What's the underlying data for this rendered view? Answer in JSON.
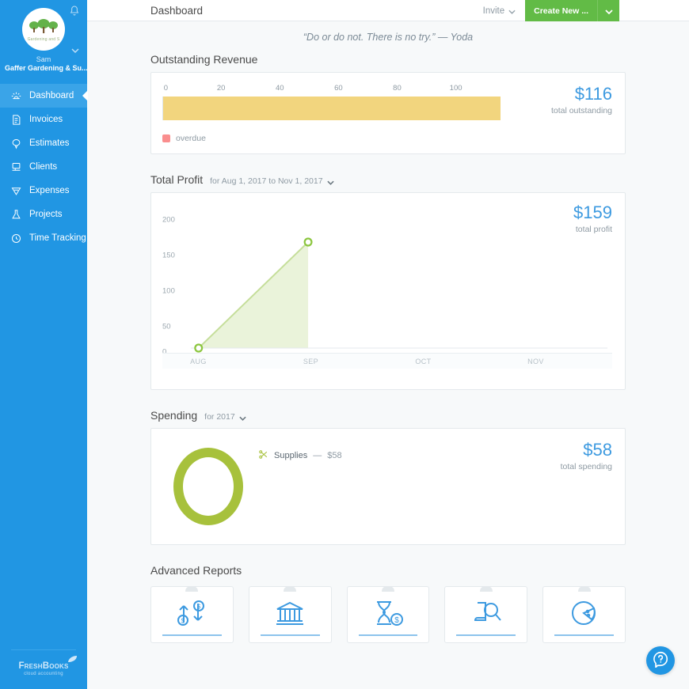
{
  "sidebar": {
    "bell_icon": "bell-icon",
    "avatar_icon": "gardening-trees-avatar",
    "avatar_caption": "Gardening and S",
    "user_name": "Sam",
    "company": "Gaffer Gardening & Su...",
    "account_caret": "chevron-down-icon",
    "items": [
      {
        "label": "Dashboard",
        "icon": "dashboard-sun-icon",
        "active": true
      },
      {
        "label": "Invoices",
        "icon": "invoice-icon",
        "active": false
      },
      {
        "label": "Estimates",
        "icon": "estimate-balloon-icon",
        "active": false
      },
      {
        "label": "Clients",
        "icon": "clients-icon",
        "active": false
      },
      {
        "label": "Expenses",
        "icon": "expenses-receipt-icon",
        "active": false
      },
      {
        "label": "Projects",
        "icon": "projects-flask-icon",
        "active": false
      },
      {
        "label": "Time Tracking",
        "icon": "clock-icon",
        "active": false
      }
    ],
    "footer_logo": "FreshBooks",
    "footer_tagline": "cloud accounting"
  },
  "topbar": {
    "title": "Dashboard",
    "invite_label": "Invite",
    "create_label": "Create New ...",
    "create_caret": "chevron-down-icon"
  },
  "quote": "“Do or do not. There is no try.” — Yoda",
  "outstanding": {
    "title": "Outstanding Revenue",
    "total": "$116",
    "total_label": "total outstanding",
    "legend_label": "overdue",
    "legend_color": "#fa8e8e",
    "bar_color": "#f2d57e"
  },
  "profit": {
    "title": "Total Profit",
    "range_label": "for Aug 1, 2017 to Nov 1, 2017",
    "range_caret": "chevron-down-icon",
    "total": "$159",
    "total_label": "total profit",
    "line_color": "#8cc63f",
    "fill_color": "#eaf3da"
  },
  "spending": {
    "title": "Spending",
    "range_label": "for 2017",
    "range_caret": "chevron-down-icon",
    "total": "$58",
    "total_label": "total spending",
    "donut_color": "#a7c13c",
    "legend": {
      "icon": "supplies-scissors-icon",
      "label": "Supplies",
      "dash": "—",
      "amount": "$58"
    }
  },
  "reports": {
    "title": "Advanced Reports",
    "cards": [
      {
        "icon": "cash-flow-icon"
      },
      {
        "icon": "bank-balance-sheet-icon"
      },
      {
        "icon": "hourglass-payments-icon"
      },
      {
        "icon": "document-search-icon"
      },
      {
        "icon": "pie-chart-icon"
      }
    ]
  },
  "help": {
    "icon": "help-question-icon"
  },
  "chart_data": [
    {
      "type": "bar",
      "title": "Outstanding Revenue",
      "categories": [
        "outstanding"
      ],
      "values": [
        116
      ],
      "xlabel": "",
      "ylabel": "",
      "xlim": [
        0,
        125
      ],
      "xticks": [
        0,
        20,
        40,
        60,
        80,
        100
      ],
      "xtick_labels": [
        "0",
        "20",
        "40",
        "60",
        "80",
        "100"
      ],
      "orientation": "horizontal",
      "bar_color": "#f2d57e",
      "legend": [
        {
          "name": "overdue",
          "color": "#fa8e8e"
        }
      ],
      "grid": false,
      "annotation": "$116 total outstanding"
    },
    {
      "type": "area",
      "title": "Total Profit",
      "subtitle": "for Aug 1, 2017 to Nov 1, 2017",
      "x": [
        "AUG",
        "SEP",
        "OCT",
        "NOV"
      ],
      "series": [
        {
          "name": "profit",
          "values": [
            0,
            159,
            null,
            null
          ]
        }
      ],
      "xlabel": "",
      "ylabel": "",
      "ylim": [
        0,
        215
      ],
      "yticks": [
        0,
        50,
        100,
        150,
        200
      ],
      "ytick_labels": [
        "0",
        "50",
        "100",
        "150",
        "200"
      ],
      "line_color": "#8cc63f",
      "fill_color": "#eaf3da",
      "markers": true,
      "grid": false,
      "annotation": "$159 total profit"
    },
    {
      "type": "pie",
      "title": "Spending",
      "subtitle": "for 2017",
      "labels": [
        "Supplies"
      ],
      "values": [
        58
      ],
      "colors": [
        "#a7c13c"
      ],
      "donut": true,
      "legend_position": "right-of-chart",
      "annotation": "$58 total spending"
    }
  ]
}
